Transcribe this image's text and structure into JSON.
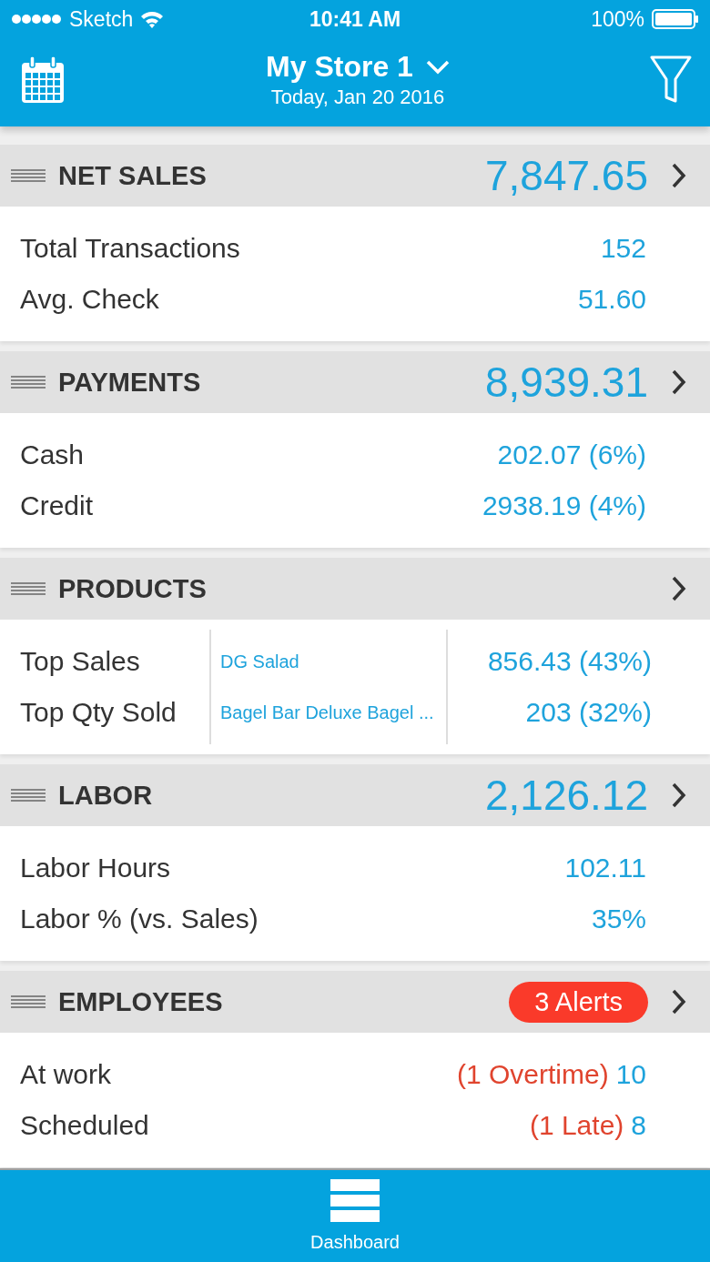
{
  "status_bar": {
    "carrier": "Sketch",
    "time": "10:41 AM",
    "battery": "100%"
  },
  "nav_bar": {
    "title": "My Store 1",
    "subtitle": "Today, Jan 20 2016"
  },
  "sections": [
    {
      "title": "NET SALES",
      "total": "7,847.65",
      "rows": [
        {
          "kind": "plain",
          "label": "Total Transactions",
          "value": "152"
        },
        {
          "kind": "plain",
          "label": "Avg. Check",
          "value": "51.60"
        }
      ]
    },
    {
      "title": "PAYMENTS",
      "total": "8,939.31",
      "rows": [
        {
          "kind": "plain",
          "label": "Cash",
          "value": "202.07 (6%)"
        },
        {
          "kind": "plain",
          "label": "Credit",
          "value": "2938.19 (4%)"
        }
      ]
    },
    {
      "title": "PRODUCTS",
      "rows": [
        {
          "kind": "item",
          "label": "Top Sales",
          "item": "DG Salad",
          "value": "856.43 (43%)"
        },
        {
          "kind": "item",
          "label": "Top Qty Sold",
          "item": "Bagel Bar Deluxe Bagel ...",
          "value": "203 (32%)"
        }
      ]
    },
    {
      "title": "LABOR",
      "total": "2,126.12",
      "rows": [
        {
          "kind": "plain",
          "label": "Labor Hours",
          "value": "102.11"
        },
        {
          "kind": "plain",
          "label": "Labor % (vs. Sales)",
          "value": "35%"
        }
      ]
    },
    {
      "title": "EMPLOYEES",
      "badge": "3 Alerts",
      "rows": [
        {
          "kind": "alert",
          "label": "At work",
          "note": "(1 Overtime)",
          "value": "10"
        },
        {
          "kind": "alert",
          "label": "Scheduled",
          "note": "(1 Late)",
          "value": "8"
        }
      ]
    }
  ],
  "tab_bar": {
    "label": "Dashboard"
  }
}
